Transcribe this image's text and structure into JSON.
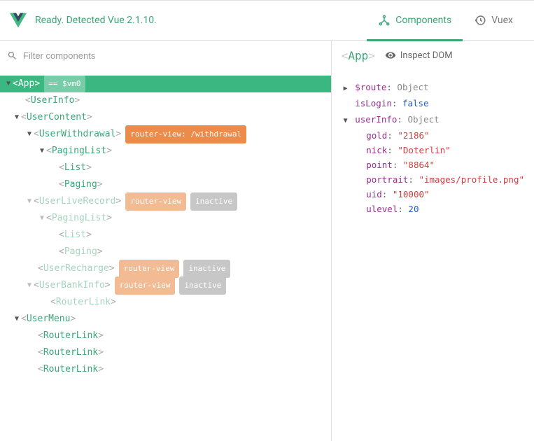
{
  "header": {
    "status": "Ready. Detected Vue 2.1.10.",
    "tabs": {
      "components": "Components",
      "vuex": "Vuex"
    }
  },
  "filter": {
    "placeholder": "Filter components"
  },
  "tree": {
    "root": "App",
    "root_eq": "== $vm0",
    "nodes": {
      "userInfo": "UserInfo",
      "userContent": "UserContent",
      "userWithdrawal": "UserWithdrawal",
      "router_withdrawal": "router-view: /withdrawal",
      "pagingList": "PagingList",
      "list": "List",
      "paging": "Paging",
      "userLiveRecord": "UserLiveRecord",
      "router_view": "router-view",
      "inactive": "inactive",
      "pagingList2": "PagingList",
      "list2": "List",
      "paging2": "Paging",
      "userRecharge": "UserRecharge",
      "userBankInfo": "UserBankInfo",
      "routerLink": "RouterLink",
      "userMenu": "UserMenu",
      "routerLink1": "RouterLink",
      "routerLink2": "RouterLink",
      "routerLink3": "RouterLink"
    }
  },
  "right": {
    "selected": "App",
    "inspect": "Inspect DOM",
    "props": {
      "route": {
        "key": "$route",
        "type": "Object"
      },
      "isLogin": {
        "key": "isLogin",
        "val": "false"
      },
      "userInfo": {
        "key": "userInfo",
        "type": "Object",
        "children": {
          "gold": {
            "key": "gold",
            "val": "\"2186\""
          },
          "nick": {
            "key": "nick",
            "val": "\"Doterlin\""
          },
          "point": {
            "key": "point",
            "val": "\"8864\""
          },
          "portrait": {
            "key": "portrait",
            "val": "\"images/profile.png\""
          },
          "uid": {
            "key": "uid",
            "val": "\"10000\""
          },
          "ulevel": {
            "key": "ulevel",
            "val": "20"
          }
        }
      }
    }
  }
}
